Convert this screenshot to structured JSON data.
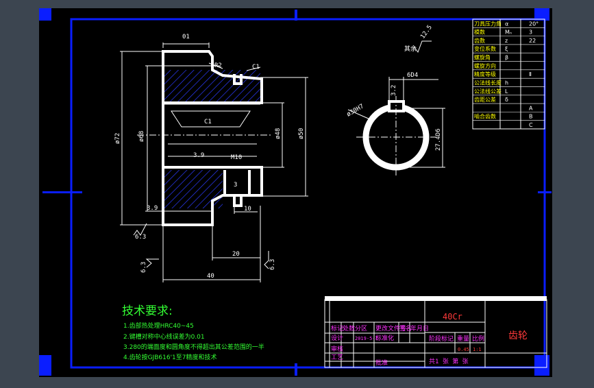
{
  "colors": {
    "background": "#3c4550",
    "paper": "#000000",
    "frame": "#0a1eff",
    "outline": "#ffffff",
    "dimension": "#ffffff",
    "text_green": "#33ff33",
    "text_yellow": "#ffff00",
    "text_red": "#ff3a3a",
    "text_magenta": "#ff33ff",
    "hatch": "#2c3cff",
    "table_line": "#ffffff"
  },
  "dimensions": {
    "tolerance_top": "01",
    "radius": "R2",
    "tolerance_mid": "C1",
    "tolerance_bore": "C1",
    "dia_outer": "ø72",
    "dia_root": "ø68",
    "dia_hub": "ø48",
    "dia_shaft": "ø50",
    "chamfer_left": "3.9",
    "chamfer_bottom": "3.9",
    "slot_width": "M10",
    "slot_small": "3",
    "length_10": "10",
    "length_20": "20",
    "length_40": "40",
    "rough_left": "6.3",
    "rough_bottom": "6.3",
    "rough_right": "6.3",
    "rough_other": "12.5",
    "rough_other_label": "其余",
    "key_width": "6D4",
    "key_depth": "3.2",
    "bore_dia": "ø30H7",
    "keyway_dim": "27.4D6"
  },
  "params_table": {
    "rows": [
      {
        "label": "刀具压力角",
        "sym": "α",
        "value": "20°"
      },
      {
        "label": "模数",
        "sym": "Mₙ",
        "value": "3"
      },
      {
        "label": "齿数",
        "sym": "z",
        "value": "22"
      },
      {
        "label": "变位系数",
        "sym": "ξ",
        "value": ""
      },
      {
        "label": "螺旋角",
        "sym": "β",
        "value": ""
      },
      {
        "label": "螺旋方向",
        "sym": "",
        "value": ""
      },
      {
        "label": "精度等级",
        "sym": "",
        "value": "Ⅱ"
      },
      {
        "label": "公法线长度",
        "sym": "h",
        "value": ""
      },
      {
        "label": "公法线公差",
        "sym": "L",
        "value": ""
      },
      {
        "label": "齿距公差",
        "sym": "δ",
        "value": ""
      },
      {
        "label": "",
        "sym": "",
        "value": "A"
      },
      {
        "label": "啮合齿数",
        "sym": "",
        "value": "B"
      },
      {
        "label": "",
        "sym": "",
        "value": "C"
      }
    ]
  },
  "tech_requirements": {
    "title": "技术要求:",
    "items": [
      "1.齿部热处理HRC40~45",
      "2.键槽对称中心线误差为0.01",
      "3.280的端面度和圆角度不得超出其公差范围的一半",
      "4.齿轮按GJB616'1至7精度和技术"
    ]
  },
  "title_block": {
    "material": "40Cr",
    "part_name": "齿轮",
    "header_cells": [
      "标记",
      "处数",
      "分区",
      "更改文件号",
      "签名",
      "年月日"
    ],
    "design": "设计",
    "std": "标准化",
    "review": "审核",
    "process": "工艺",
    "approve": "批准",
    "stage_label": "阶段标记",
    "weight_label": "重量",
    "scale_label": "比例",
    "weight": "0.45",
    "scale": "1:1",
    "sheets": "共1 张 第 张",
    "date": "2019-5-1"
  }
}
